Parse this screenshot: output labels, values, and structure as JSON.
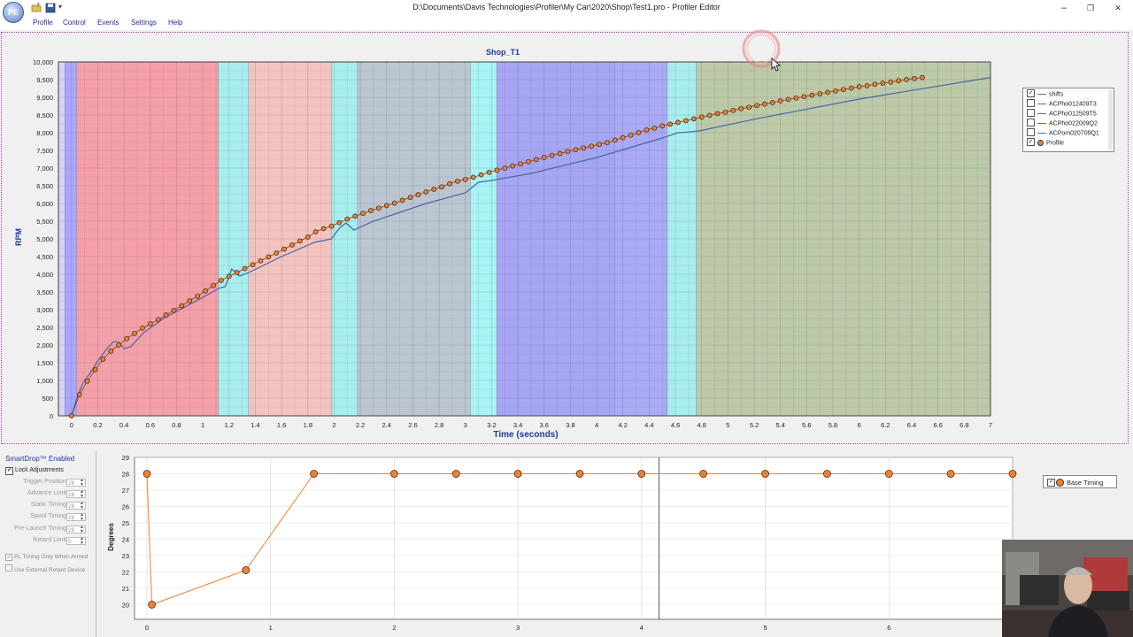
{
  "window": {
    "title": "D:\\Documents\\Davis Technologies\\Profiler\\My Car\\2020\\Shop\\Test1.pro - Profiler Editor",
    "app_icon_text": "PE",
    "controls": {
      "minimize": "–",
      "restore": "❐",
      "close": "✕"
    }
  },
  "menu": [
    "Profile",
    "Control",
    "Events",
    "Settings",
    "Help"
  ],
  "chart_data": [
    {
      "type": "line",
      "title": "Shop_T1",
      "xlabel": "Time (seconds)",
      "ylabel": "RPM",
      "xlim": [
        -0.1,
        7
      ],
      "ylim": [
        0,
        10000
      ],
      "x_ticks": [
        "0",
        "0.2",
        "0.4",
        "0.6",
        "0.8",
        "1",
        "1.2",
        "1.4",
        "1.6",
        "1.8",
        "2",
        "2.2",
        "2.4",
        "2.6",
        "2.8",
        "3",
        "3.2",
        "3.4",
        "3.6",
        "3.8",
        "4",
        "4.2",
        "4.4",
        "4.6",
        "4.8",
        "5",
        "5.2",
        "5.4",
        "5.6",
        "5.8",
        "6",
        "6.2",
        "6.4",
        "6.6",
        "6.8",
        "7"
      ],
      "y_ticks": [
        "0",
        "500",
        "1,000",
        "1,500",
        "2,000",
        "2,500",
        "3,000",
        "3,500",
        "4,000",
        "4,500",
        "5,000",
        "5,500",
        "6,000",
        "6,500",
        "7,000",
        "7,500",
        "8,000",
        "8,500",
        "9,000",
        "9,500",
        "10,000"
      ],
      "legend": [
        {
          "name": "shifts",
          "checked": true,
          "marker": "line"
        },
        {
          "name": "ACPho012409T3",
          "checked": false,
          "marker": "line"
        },
        {
          "name": "ACPho012509T5",
          "checked": false,
          "marker": "line"
        },
        {
          "name": "ACPho022009Q2",
          "checked": false,
          "marker": "line"
        },
        {
          "name": "ACPom020709Q1",
          "checked": false,
          "marker": "line"
        },
        {
          "name": "Profile",
          "checked": true,
          "marker": "dot"
        }
      ],
      "legend_position": "right",
      "bands": [
        {
          "x0": -0.1,
          "x1": -0.05,
          "color": "#d6d4f0"
        },
        {
          "x0": -0.05,
          "x1": 0.04,
          "color": "#a8a8ff"
        },
        {
          "x0": 0.04,
          "x1": 1.12,
          "color": "#f5a0a8"
        },
        {
          "x0": 1.12,
          "x1": 1.35,
          "color": "#a8eeee"
        },
        {
          "x0": 1.35,
          "x1": 1.98,
          "color": "#f3c4bf"
        },
        {
          "x0": 1.98,
          "x1": 2.18,
          "color": "#a8eeee"
        },
        {
          "x0": 2.18,
          "x1": 3.04,
          "color": "#bcc6d0"
        },
        {
          "x0": 3.04,
          "x1": 3.24,
          "color": "#a8f4f4"
        },
        {
          "x0": 3.24,
          "x1": 4.14,
          "color": "#a6a6f4"
        },
        {
          "x0": 4.14,
          "x1": 4.54,
          "color": "#aaaaf6"
        },
        {
          "x0": 4.54,
          "x1": 4.76,
          "color": "#a8eeee"
        },
        {
          "x0": 4.76,
          "x1": 7.0,
          "color": "#bccaa8"
        }
      ],
      "series": [
        {
          "name": "Profile",
          "color": "#f08030",
          "x_start": 0,
          "x_step": 0.06,
          "values": [
            0,
            600,
            980,
            1300,
            1600,
            1830,
            2000,
            2180,
            2330,
            2480,
            2600,
            2720,
            2850,
            2980,
            3110,
            3250,
            3380,
            3530,
            3680,
            3830,
            3940,
            4050,
            4160,
            4270,
            4380,
            4490,
            4600,
            4710,
            4830,
            4940,
            5050,
            5200,
            5290,
            5360,
            5460,
            5560,
            5640,
            5720,
            5800,
            5870,
            5940,
            6010,
            6090,
            6170,
            6250,
            6330,
            6400,
            6470,
            6560,
            6630,
            6680,
            6740,
            6810,
            6880,
            6940,
            7000,
            7060,
            7120,
            7180,
            7240,
            7300,
            7360,
            7410,
            7470,
            7520,
            7570,
            7620,
            7670,
            7720,
            7790,
            7860,
            7930,
            8000,
            8080,
            8130,
            8190,
            8240,
            8290,
            8340,
            8390,
            8440,
            8490,
            8540,
            8580,
            8630,
            8680,
            8720,
            8770,
            8810,
            8850,
            8900,
            8940,
            8980,
            9020,
            9060,
            9100,
            9140,
            9180,
            9220,
            9260,
            9300,
            9330,
            9370,
            9400,
            9430,
            9470,
            9500,
            9530,
            9560
          ]
        },
        {
          "name": "shifts",
          "color": "#4466aa",
          "points": [
            [
              0,
              0
            ],
            [
              0.05,
              600
            ],
            [
              0.09,
              950
            ],
            [
              0.14,
              1200
            ],
            [
              0.2,
              1550
            ],
            [
              0.27,
              1900
            ],
            [
              0.32,
              2100
            ],
            [
              0.36,
              2080
            ],
            [
              0.4,
              1900
            ],
            [
              0.45,
              1950
            ],
            [
              0.55,
              2350
            ],
            [
              0.7,
              2750
            ],
            [
              0.9,
              3150
            ],
            [
              1.05,
              3450
            ],
            [
              1.12,
              3600
            ],
            [
              1.17,
              3650
            ],
            [
              1.22,
              4150
            ],
            [
              1.28,
              3950
            ],
            [
              1.35,
              4050
            ],
            [
              1.6,
              4500
            ],
            [
              1.85,
              4900
            ],
            [
              1.98,
              5000
            ],
            [
              2.04,
              5300
            ],
            [
              2.09,
              5450
            ],
            [
              2.15,
              5250
            ],
            [
              2.3,
              5500
            ],
            [
              2.7,
              6000
            ],
            [
              3.0,
              6300
            ],
            [
              3.1,
              6600
            ],
            [
              3.2,
              6650
            ],
            [
              3.5,
              6850
            ],
            [
              4.0,
              7300
            ],
            [
              4.5,
              7850
            ],
            [
              4.62,
              8000
            ],
            [
              4.7,
              8020
            ],
            [
              4.78,
              8050
            ],
            [
              5.2,
              8380
            ],
            [
              6.0,
              8950
            ],
            [
              7.0,
              9560
            ]
          ]
        }
      ]
    },
    {
      "type": "line",
      "ylabel": "Degrees",
      "xlim": [
        -0.1,
        7
      ],
      "ylim": [
        19.1,
        29
      ],
      "x_ticks": [
        "0",
        "1",
        "2",
        "3",
        "4",
        "5",
        "6"
      ],
      "y_ticks": [
        "20",
        "21",
        "22",
        "23",
        "24",
        "25",
        "26",
        "27",
        "28",
        "29"
      ],
      "legend": [
        {
          "name": "Base Timing",
          "checked": true
        }
      ],
      "series": [
        {
          "name": "Base Timing",
          "color": "#f08030",
          "points": [
            [
              0,
              28
            ],
            [
              0.04,
              20
            ],
            [
              0.8,
              22.1
            ],
            [
              1.35,
              28
            ],
            [
              2,
              28
            ],
            [
              2.5,
              28
            ],
            [
              3,
              28
            ],
            [
              3.5,
              28
            ],
            [
              4,
              28
            ],
            [
              4.5,
              28
            ],
            [
              5,
              28
            ],
            [
              5.5,
              28
            ],
            [
              6,
              28
            ],
            [
              6.5,
              28
            ],
            [
              7,
              28
            ]
          ]
        }
      ]
    }
  ],
  "smartdrop": {
    "status": "SmartDrop™ Enabled",
    "lock_label": "Lock Adjustments",
    "lock_checked": "✔",
    "settings": [
      {
        "label": "Trigger Position",
        "value": "28"
      },
      {
        "label": "Advance Limit",
        "value": "28"
      },
      {
        "label": "Static Timing",
        "value": "28"
      },
      {
        "label": "Spool Timing",
        "value": "28"
      },
      {
        "label": "Pre-Launch Timing",
        "value": "28"
      },
      {
        "label": "Retard Limit",
        "value": "5"
      }
    ],
    "pl_timing_label": "PL Timing Only When Armed",
    "pl_timing_checked": "✔",
    "ext_retard_label": "Use External Retard Device"
  }
}
